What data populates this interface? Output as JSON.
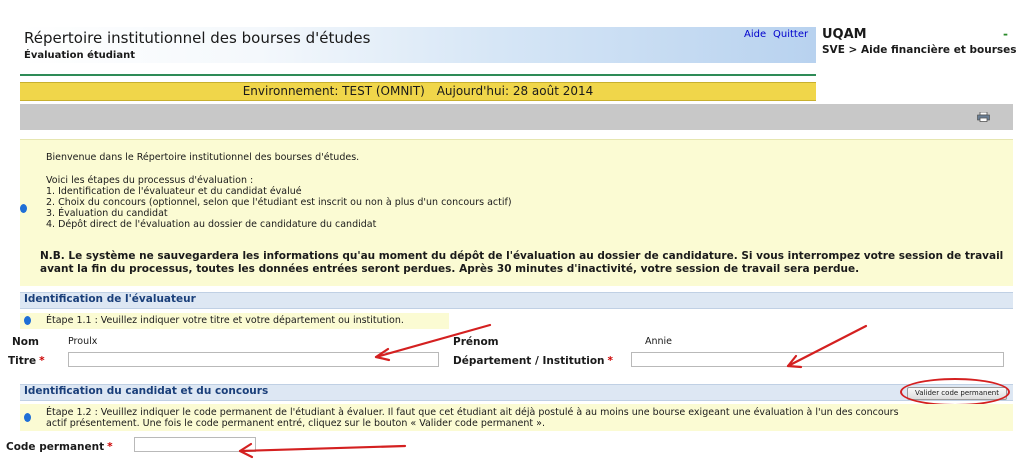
{
  "header": {
    "title": "Répertoire institutionnel des bourses d'études",
    "subtitle": "Évaluation étudiant",
    "links": [
      "Aide",
      "Quitter"
    ],
    "org": "UQAM",
    "org_suffix": "-",
    "breadcrumb": "SVE > Aide financière et bourses"
  },
  "environment": {
    "label": "Environnement: TEST (OMNIT)",
    "date": "Aujourd'hui: 28 août 2014"
  },
  "toolbar": {
    "print_icon": "printer-icon"
  },
  "intro": {
    "welcome": "Bienvenue dans le Répertoire institutionnel des bourses d'études.",
    "steps_heading": "Voici les étapes du processus d'évaluation :",
    "steps": [
      "1.  Identification de l'évaluateur et du candidat évalué",
      "2.  Choix du concours (optionnel, selon que l'étudiant est inscrit ou non à plus d'un concours actif)",
      "3.  Évaluation du candidat",
      "4.  Dépôt direct de l'évaluation au dossier de candidature du candidat"
    ],
    "note_line1": "N.B. Le système ne sauvegardera les informations qu'au moment du dépôt de l'évaluation au dossier de candidature. Si vous interrompez votre session de travail",
    "note_line2": "avant la fin du processus, toutes les données entrées seront perdues. Après 30 minutes d'inactivité, votre session de travail sera perdue."
  },
  "evaluator": {
    "section_title": "Identification de l'évaluateur",
    "step": "Étape 1.1 : Veuillez indiquer votre titre et votre département ou institution.",
    "nom_label": "Nom",
    "nom_value": "Proulx",
    "prenom_label": "Prénom",
    "prenom_value": "Annie",
    "titre_label": "Titre",
    "titre_value": "",
    "dept_label": "Département / Institution",
    "dept_value": "",
    "required_mark": "*"
  },
  "candidate": {
    "section_title": "Identification du candidat et du concours",
    "button": "Valider code permanent",
    "step_line1": "Étape 1.2 : Veuillez indiquer le code permanent de l'étudiant à évaluer. Il faut que cet étudiant ait déjà postulé à au moins une bourse exigeant une évaluation à l'un des concours",
    "step_line2": "actif présentement. Une fois le code permanent entré, cliquez sur le bouton « Valider code permanent ».",
    "code_label": "Code permanent",
    "code_value": "",
    "required_mark": "*"
  },
  "colors": {
    "env_bar": "#f0d64a",
    "info_bg": "#fbfbd3",
    "section_bg": "#dde7f3",
    "annotation_red": "#d42020"
  }
}
